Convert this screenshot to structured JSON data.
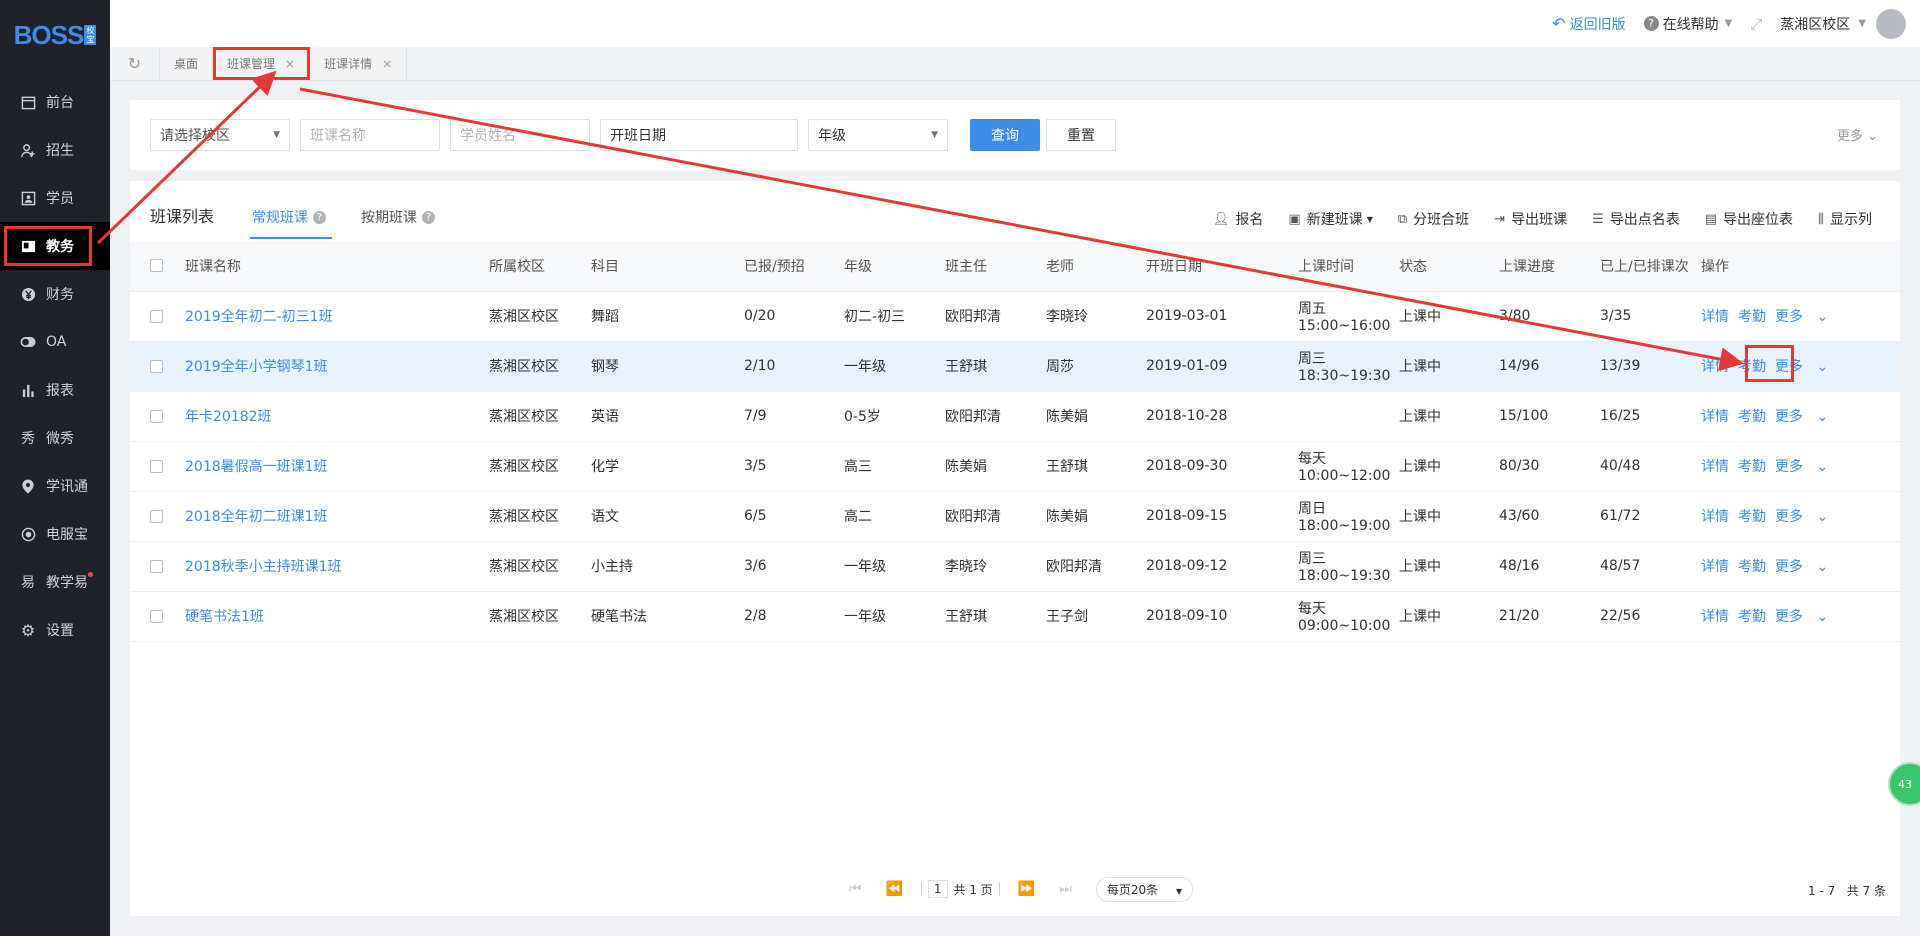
{
  "app": {
    "logo_text": "BOSS",
    "logo_tag": "校宝"
  },
  "sidebar": {
    "items": [
      {
        "label": "前台",
        "icon": "calendar-icon"
      },
      {
        "label": "招生",
        "icon": "user-plus-icon"
      },
      {
        "label": "学员",
        "icon": "id-card-icon"
      },
      {
        "label": "教务",
        "icon": "book-icon",
        "active": true
      },
      {
        "label": "财务",
        "icon": "yen-icon"
      },
      {
        "label": "OA",
        "icon": "toggle-icon"
      },
      {
        "label": "报表",
        "icon": "bar-chart-icon"
      },
      {
        "label": "微秀",
        "icon": "weixiu-icon"
      },
      {
        "label": "学讯通",
        "icon": "location-icon"
      },
      {
        "label": "电服宝",
        "icon": "phone-icon"
      },
      {
        "label": "教学易",
        "icon": "jiaoxueyi-icon"
      },
      {
        "label": "设置",
        "icon": "gear-icon"
      }
    ]
  },
  "topbar": {
    "back_label": "返回旧版",
    "help_label": "在线帮助",
    "campus_label": "蒸湘区校区"
  },
  "tabs": [
    {
      "label": "桌面",
      "closable": false
    },
    {
      "label": "班课管理",
      "closable": true,
      "highlighted": true
    },
    {
      "label": "班课详情",
      "closable": true
    }
  ],
  "filter": {
    "campus_placeholder": "请选择校区",
    "class_name_placeholder": "班课名称",
    "student_name_placeholder": "学员姓名",
    "start_date_label": "开班日期",
    "grade_label": "年级",
    "query_label": "查询",
    "reset_label": "重置",
    "more_label": "更多"
  },
  "panel": {
    "title": "班课列表",
    "tab_regular": "常规班课",
    "tab_period": "按期班课",
    "toolbar": {
      "enroll": "报名",
      "new_class": "新建班课",
      "split_merge": "分班合班",
      "export_class": "导出班课",
      "export_roll": "导出点名表",
      "export_seat": "导出座位表",
      "show_columns": "显示列"
    }
  },
  "table": {
    "headers": [
      "班课名称",
      "所属校区",
      "科目",
      "已报/预招",
      "年级",
      "班主任",
      "老师",
      "开班日期",
      "上课时间",
      "状态",
      "上课进度",
      "已上/已排课次",
      "操作"
    ],
    "rows": [
      [
        "2019全年初二-初三1班",
        "蒸湘区校区",
        "舞蹈",
        "0/20",
        "初二-初三",
        "欧阳邦清",
        "李晓玲",
        "2019-03-01",
        "周五15:00~16:00",
        "上课中",
        "3/80",
        "3/35"
      ],
      [
        "2019全年小学钢琴1班",
        "蒸湘区校区",
        "钢琴",
        "2/10",
        "一年级",
        "王舒琪",
        "周莎",
        "2019-01-09",
        "周三18:30~19:30",
        "上课中",
        "14/96",
        "13/39"
      ],
      [
        "年卡20182班",
        "蒸湘区校区",
        "英语",
        "7/9",
        "0-5岁",
        "欧阳邦清",
        "陈美娟",
        "2018-10-28",
        "",
        "上课中",
        "15/100",
        "16/25"
      ],
      [
        "2018暑假高一班课1班",
        "蒸湘区校区",
        "化学",
        "3/5",
        "高三",
        "陈美娟",
        "王舒琪",
        "2018-09-30",
        "每天10:00~12:00",
        "上课中",
        "80/30",
        "40/48"
      ],
      [
        "2018全年初二班课1班",
        "蒸湘区校区",
        "语文",
        "6/5",
        "高二",
        "欧阳邦清",
        "陈美娟",
        "2018-09-15",
        "周日18:00~19:00",
        "上课中",
        "43/60",
        "61/72"
      ],
      [
        "2018秋季小主持班课1班",
        "蒸湘区校区",
        "小主持",
        "3/6",
        "一年级",
        "李晓玲",
        "欧阳邦清",
        "2018-09-12",
        "周三18:00~19:30",
        "上课中",
        "48/16",
        "48/57"
      ],
      [
        "硬笔书法1班",
        "蒸湘区校区",
        "硬笔书法",
        "2/8",
        "一年级",
        "王舒琪",
        "王子剑",
        "2018-09-10",
        "每天09:00~10:00",
        "上课中",
        "21/20",
        "22/56"
      ]
    ],
    "ops": {
      "detail": "详情",
      "attendance": "考勤",
      "more": "更多"
    }
  },
  "pager": {
    "page": "1",
    "total_pages": "共 1 页",
    "page_size": "每页20条",
    "range": "1 - 7",
    "total": "共 7 条"
  },
  "float_badge": "43",
  "colors": {
    "accent": "#3d8de8",
    "sidebar_bg": "#1f2329",
    "highlight": "#e53935",
    "selected_row": "#e8f1fc"
  }
}
